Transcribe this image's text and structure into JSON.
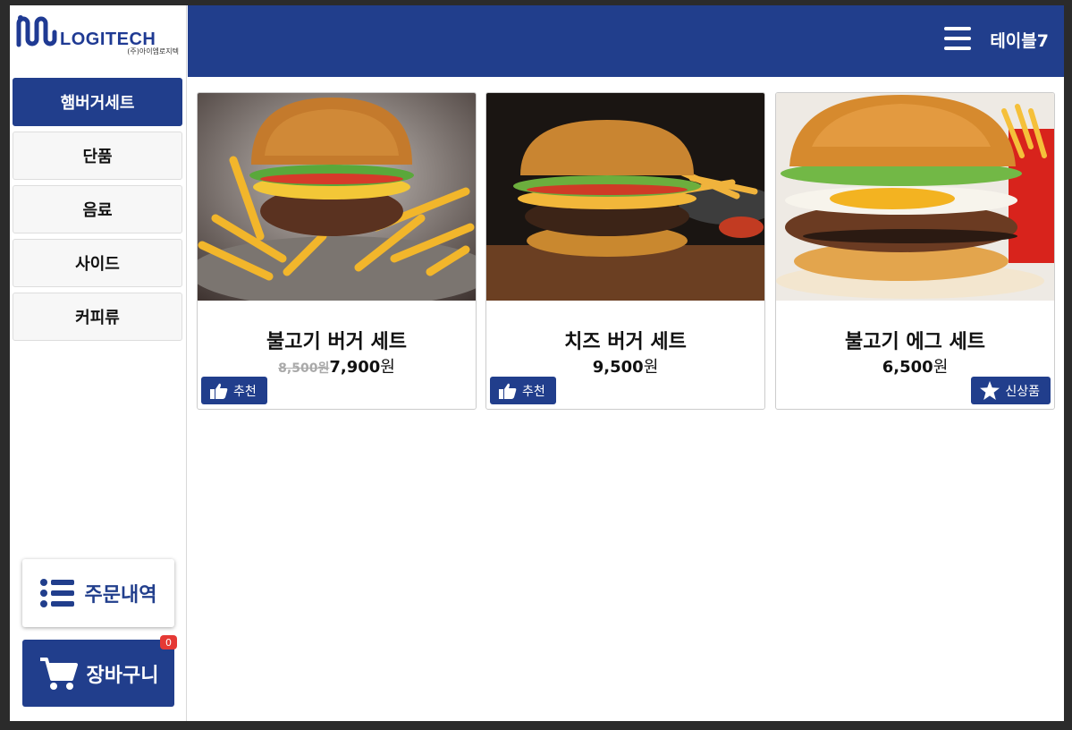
{
  "brand": {
    "name": "LOGITECH",
    "subtitle": "(주)아이엠로지텍"
  },
  "header": {
    "table_label": "테이블7"
  },
  "categories": [
    {
      "label": "햄버거세트",
      "active": true
    },
    {
      "label": "단품",
      "active": false
    },
    {
      "label": "음료",
      "active": false
    },
    {
      "label": "사이드",
      "active": false
    },
    {
      "label": "커피류",
      "active": false
    }
  ],
  "actions": {
    "order_history": "주문내역",
    "cart": "장바구니",
    "cart_count": "0"
  },
  "products": [
    {
      "name": "불고기 버거 세트",
      "original_price": "8,500원",
      "price": "7,900",
      "unit": "원",
      "tag": "추천",
      "tag_icon": "thumbs-up-icon"
    },
    {
      "name": "치즈 버거 세트",
      "original_price": "",
      "price": "9,500",
      "unit": "원",
      "tag": "추천",
      "tag_icon": "thumbs-up-icon"
    },
    {
      "name": "불고기 에그 세트",
      "original_price": "",
      "price": "6,500",
      "unit": "원",
      "tag": "신상품",
      "tag_icon": "star-icon"
    }
  ],
  "colors": {
    "primary": "#213e8c",
    "badge": "#e53935"
  }
}
